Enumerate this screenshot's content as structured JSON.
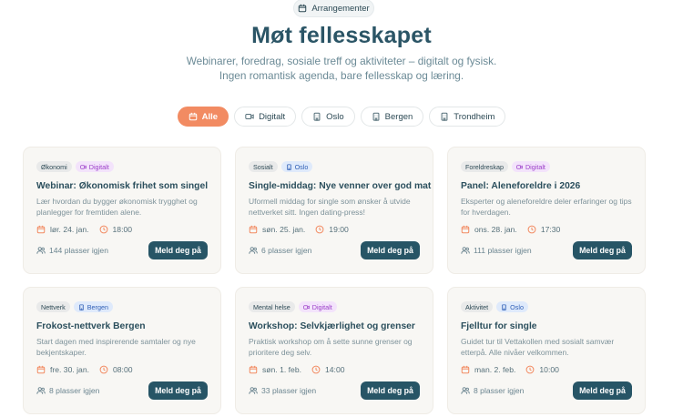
{
  "header": {
    "badge": "Arrangementer",
    "title": "Møt fellesskapet",
    "subtitle": "Webinarer, foredrag, sosiale treff og aktiviteter – digitalt og fysisk. Ingen romantisk agenda, bare fellesskap og læring."
  },
  "filters": [
    {
      "label": "Alle",
      "icon": "calendar-icon",
      "active": true
    },
    {
      "label": "Digitalt",
      "icon": "video-icon",
      "active": false
    },
    {
      "label": "Oslo",
      "icon": "building-icon",
      "active": false
    },
    {
      "label": "Bergen",
      "icon": "building-icon",
      "active": false
    },
    {
      "label": "Trondheim",
      "icon": "building-icon",
      "active": false
    }
  ],
  "events": [
    {
      "category": "Økonomi",
      "mode": "Digitalt",
      "mode_type": "digital",
      "title": "Webinar: Økonomisk frihet som singel",
      "description": "Lær hvordan du bygger økonomisk trygghet og planlegger for fremtiden alene.",
      "date": "lør. 24. jan.",
      "time": "18:00",
      "spots": "144 plasser igjen",
      "button": "Meld deg på"
    },
    {
      "category": "Sosialt",
      "mode": "Oslo",
      "mode_type": "place",
      "title": "Single-middag: Nye venner over god mat",
      "description": "Uformell middag for single som ønsker å utvide nettverket sitt. Ingen dating-press!",
      "date": "søn. 25. jan.",
      "time": "19:00",
      "spots": "6 plasser igjen",
      "button": "Meld deg på"
    },
    {
      "category": "Foreldreskap",
      "mode": "Digitalt",
      "mode_type": "digital",
      "title": "Panel: Aleneforeldre i 2026",
      "description": "Eksperter og aleneforeldre deler erfaringer og tips for hverdagen.",
      "date": "ons. 28. jan.",
      "time": "17:30",
      "spots": "111 plasser igjen",
      "button": "Meld deg på"
    },
    {
      "category": "Nettverk",
      "mode": "Bergen",
      "mode_type": "place",
      "title": "Frokost-nettverk Bergen",
      "description": "Start dagen med inspirerende samtaler og nye bekjentskaper.",
      "date": "fre. 30. jan.",
      "time": "08:00",
      "spots": "8 plasser igjen",
      "button": "Meld deg på"
    },
    {
      "category": "Mental helse",
      "mode": "Digitalt",
      "mode_type": "digital",
      "title": "Workshop: Selvkjærlighet og grenser",
      "description": "Praktisk workshop om å sette sunne grenser og prioritere deg selv.",
      "date": "søn. 1. feb.",
      "time": "14:00",
      "spots": "33 plasser igjen",
      "button": "Meld deg på"
    },
    {
      "category": "Aktivitet",
      "mode": "Oslo",
      "mode_type": "place",
      "title": "Fjelltur for single",
      "description": "Guidet tur til Vettakollen med sosialt samvær etterpå. Alle nivåer velkommen.",
      "date": "man. 2. feb.",
      "time": "10:00",
      "spots": "8 plasser igjen",
      "button": "Meld deg på"
    }
  ],
  "colors": {
    "accent": "#f28b62",
    "button": "#275566",
    "title": "#2b5566",
    "digital_tag": "#9b3ec8",
    "place_tag": "#2f5fb6"
  }
}
